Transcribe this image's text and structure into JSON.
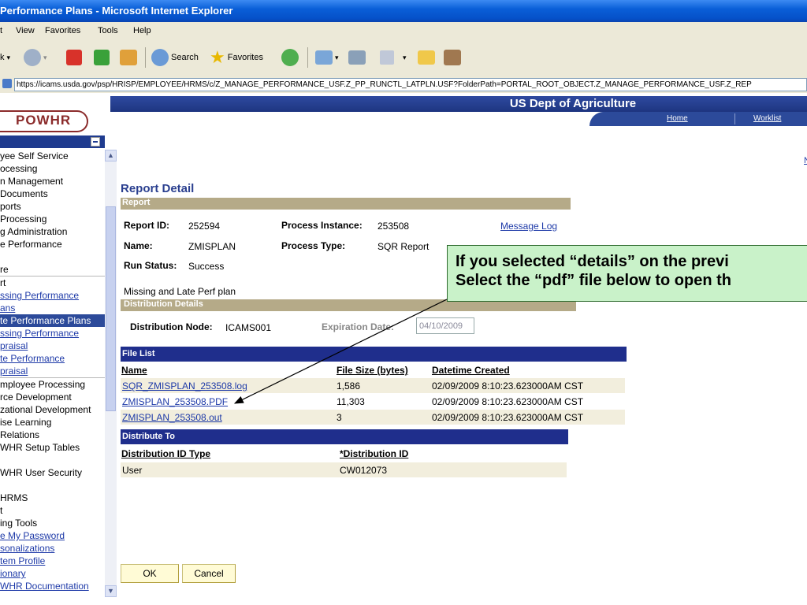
{
  "window": {
    "title": "Performance Plans - Microsoft Internet Explorer"
  },
  "menubar": [
    "t",
    "View",
    "Favorites",
    "Tools",
    "Help"
  ],
  "toolbar": {
    "search": "Search",
    "favorites": "Favorites",
    "back_partial": "k"
  },
  "address": {
    "url": "https://icams.usda.gov/psp/HRISP/EMPLOYEE/HRMS/c/Z_MANAGE_PERFORMANCE_USF.Z_PP_RUNCTL_LATPLN.USF?FolderPath=PORTAL_ROOT_OBJECT.Z_MANAGE_PERFORMANCE_USF.Z_REP"
  },
  "banner": {
    "org": "US Dept of Agriculture",
    "logo": "POWHR",
    "home": "Home",
    "worklist": "Worklist"
  },
  "sidebar": {
    "items": [
      {
        "text": "yee Self Service",
        "style": "plain"
      },
      {
        "text": "ocessing",
        "style": "plain"
      },
      {
        "text": "n Management",
        "style": "plain"
      },
      {
        "text": " Documents",
        "style": "plain"
      },
      {
        "text": "ports",
        "style": "plain"
      },
      {
        "text": " Processing",
        "style": "plain"
      },
      {
        "text": "g Administration",
        "style": "plain"
      },
      {
        "text": "e Performance",
        "style": "plain"
      },
      {
        "text": "",
        "style": "plain"
      },
      {
        "text": "re",
        "style": "plain"
      },
      {
        "text": "rt",
        "style": "line"
      },
      {
        "text": "ssing Performance",
        "style": "link"
      },
      {
        "text": "ans",
        "style": "link"
      },
      {
        "text": "te Performance Plans",
        "style": "active"
      },
      {
        "text": "ssing Performance",
        "style": "link"
      },
      {
        "text": "praisal",
        "style": "link"
      },
      {
        "text": "te Performance",
        "style": "link"
      },
      {
        "text": "praisal",
        "style": "link"
      },
      {
        "text": "mployee Processing",
        "style": "line"
      },
      {
        "text": "rce Development",
        "style": "plain"
      },
      {
        "text": "zational Development",
        "style": "plain"
      },
      {
        "text": "ise Learning",
        "style": "plain"
      },
      {
        "text": " Relations",
        "style": "plain"
      },
      {
        "text": "WHR Setup Tables",
        "style": "plain"
      },
      {
        "text": "",
        "style": "plain"
      },
      {
        "text": "WHR User Security",
        "style": "plain"
      },
      {
        "text": "",
        "style": "plain"
      },
      {
        "text": " HRMS",
        "style": "plain"
      },
      {
        "text": "t",
        "style": "plain"
      },
      {
        "text": "ing Tools",
        "style": "plain"
      },
      {
        "text": "e My Password",
        "style": "link"
      },
      {
        "text": "sonalizations",
        "style": "link"
      },
      {
        "text": "tem Profile",
        "style": "link"
      },
      {
        "text": "ionary",
        "style": "link"
      },
      {
        "text": "WHR Documentation",
        "style": "link"
      }
    ]
  },
  "report_detail": {
    "heading": "Report Detail",
    "report_bar": "Report",
    "report_id_label": "Report ID:",
    "report_id": "252594",
    "process_instance_label": "Process Instance:",
    "process_instance": "253508",
    "message_log": "Message Log",
    "name_label": "Name:",
    "name": "ZMISPLAN",
    "process_type_label": "Process Type:",
    "process_type": "SQR Report",
    "run_status_label": "Run Status:",
    "run_status": "Success",
    "description": "Missing and Late Perf plan"
  },
  "distribution_details": {
    "bar": "Distribution Details",
    "node_label": "Distribution Node:",
    "node": "ICAMS001",
    "expiration_label": "Expiration Date:",
    "expiration_value": "04/10/2009"
  },
  "file_list": {
    "bar": "File List",
    "headers": [
      "Name",
      "File Size (bytes)",
      "Datetime Created"
    ],
    "rows": [
      [
        "SQR_ZMISPLAN_253508.log",
        "1,586",
        "02/09/2009  8:10:23.623000AM CST"
      ],
      [
        "ZMISPLAN_253508.PDF",
        "11,303",
        "02/09/2009  8:10:23.623000AM CST"
      ],
      [
        "ZMISPLAN_253508.out",
        "3",
        "02/09/2009  8:10:23.623000AM CST"
      ]
    ]
  },
  "distribute_to": {
    "bar": "Distribute To",
    "headers": [
      "Distribution ID Type",
      "*Distribution ID"
    ],
    "rows": [
      [
        "User",
        "CW012073"
      ]
    ]
  },
  "buttons": {
    "ok": "OK",
    "cancel": "Cancel"
  },
  "callout": {
    "line1": "If you selected “details” on the previ",
    "line2": "Select the “pdf” file below to open th"
  },
  "misc": {
    "top_right_partial": "N"
  }
}
